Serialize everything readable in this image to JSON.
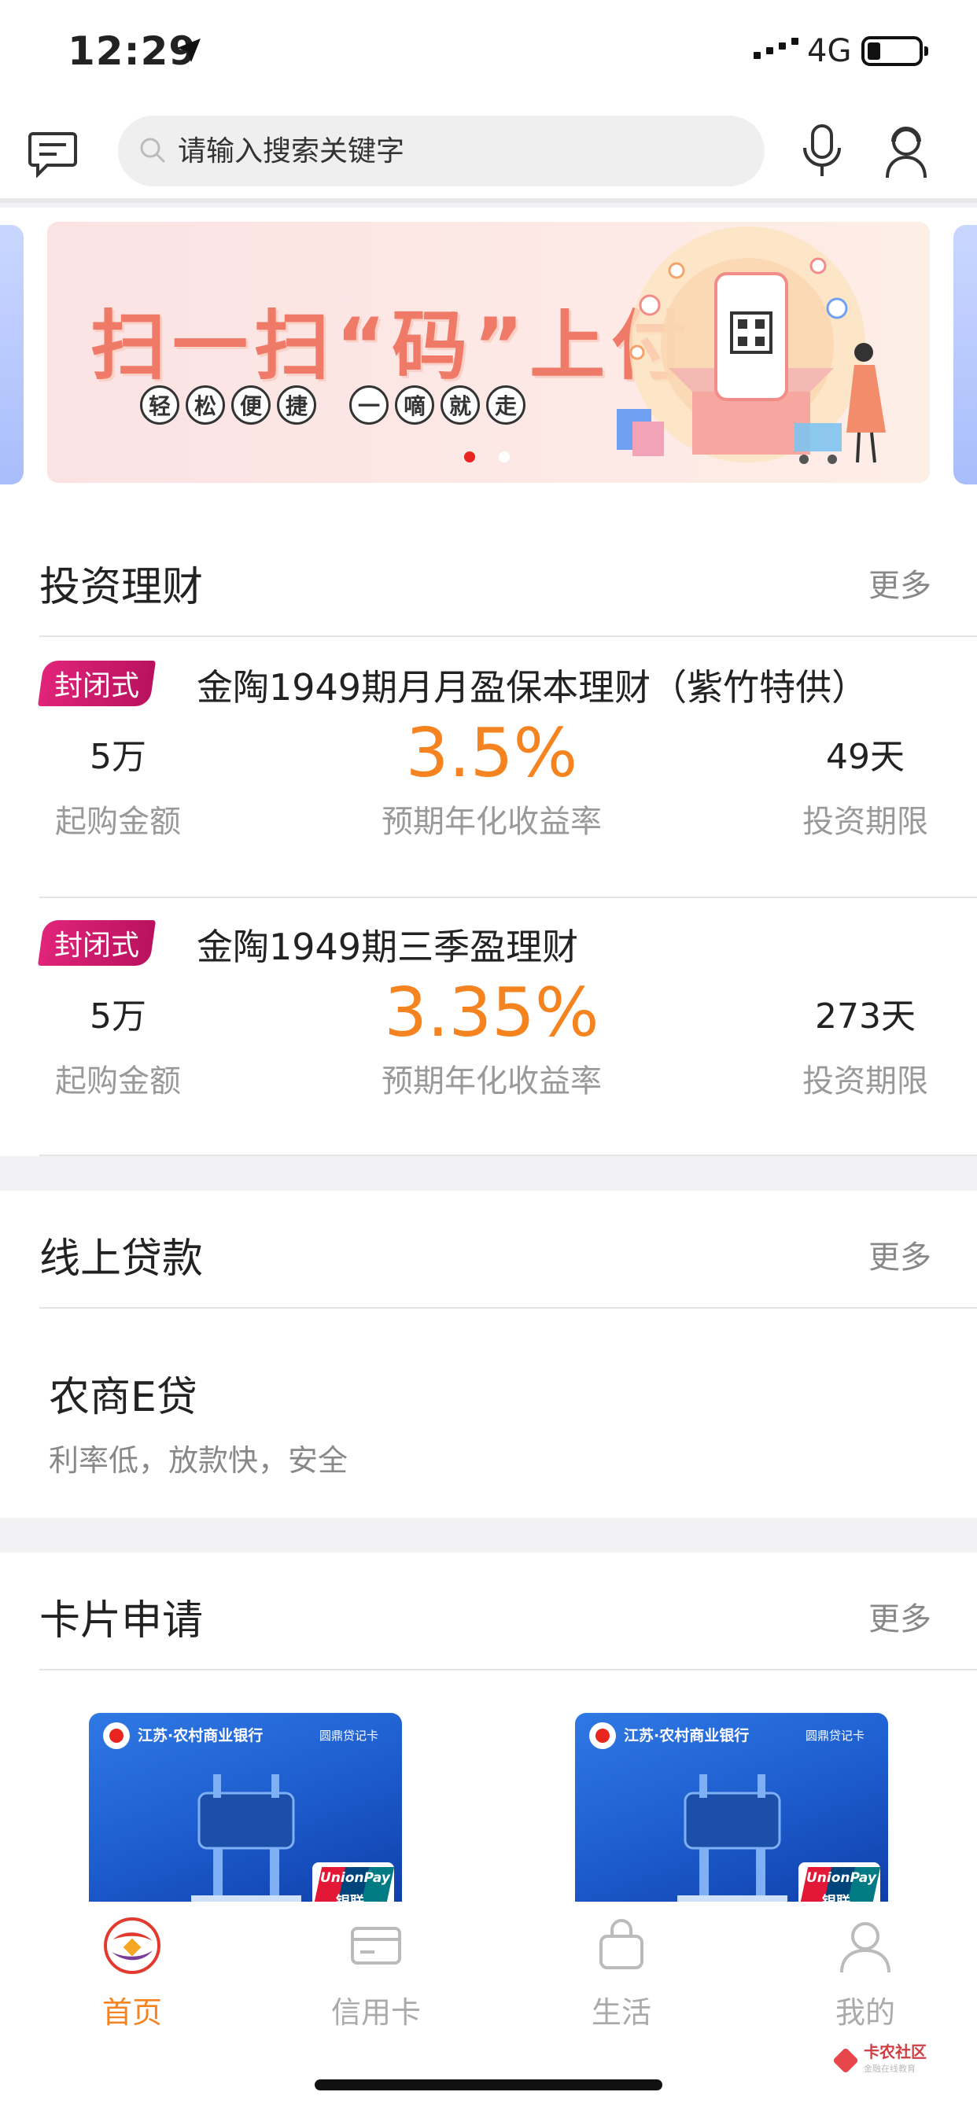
{
  "status_bar": {
    "time": "12:29",
    "network": "4G"
  },
  "header": {
    "search_placeholder": "请输入搜索关键字"
  },
  "banner": {
    "title": "扫一扫“码”上付",
    "sub_group_1": [
      "轻",
      "松",
      "便",
      "捷"
    ],
    "sub_group_2": [
      "一",
      "嘀",
      "就",
      "走"
    ],
    "active_dot": 0,
    "dot_count": 2
  },
  "invest": {
    "title": "投资理财",
    "more": "更多",
    "products": [
      {
        "tag": "封闭式",
        "name": "金陶1949期月月盈保本理财（紫竹特供）",
        "min_amount": "5万",
        "min_label": "起购金额",
        "rate": "3.5%",
        "rate_label": "预期年化收益率",
        "term": "49天",
        "term_label": "投资期限"
      },
      {
        "tag": "封闭式",
        "name": "金陶1949期三季盈理财",
        "min_amount": "5万",
        "min_label": "起购金额",
        "rate": "3.35%",
        "rate_label": "预期年化收益率",
        "term": "273天",
        "term_label": "投资期限"
      }
    ]
  },
  "loan": {
    "title": "线上贷款",
    "more": "更多",
    "name": "农商E贷",
    "desc": "利率低，放款快，安全"
  },
  "cards": {
    "title": "卡片申请",
    "more": "更多",
    "items": [
      {
        "bank": "江苏·农村商业银行",
        "kind": "圆鼎贷记卡",
        "brand_en": "UnionPay",
        "brand_cn": "银联"
      },
      {
        "bank": "江苏·农村商业银行",
        "kind": "圆鼎贷记卡",
        "brand_en": "UnionPay",
        "brand_cn": "银联"
      }
    ]
  },
  "tabbar": {
    "items": [
      {
        "label": "首页",
        "icon": "home-logo-icon",
        "active": true
      },
      {
        "label": "信用卡",
        "icon": "credit-card-icon",
        "active": false
      },
      {
        "label": "生活",
        "icon": "shopping-bag-icon",
        "active": false
      },
      {
        "label": "我的",
        "icon": "person-icon",
        "active": false
      }
    ]
  },
  "watermark": {
    "text": "卡农社区",
    "sub": "金融在线教育"
  },
  "colors": {
    "accent_orange": "#f5831f",
    "tag_pink": "#d31a6c",
    "dot_red": "#e8261f"
  }
}
